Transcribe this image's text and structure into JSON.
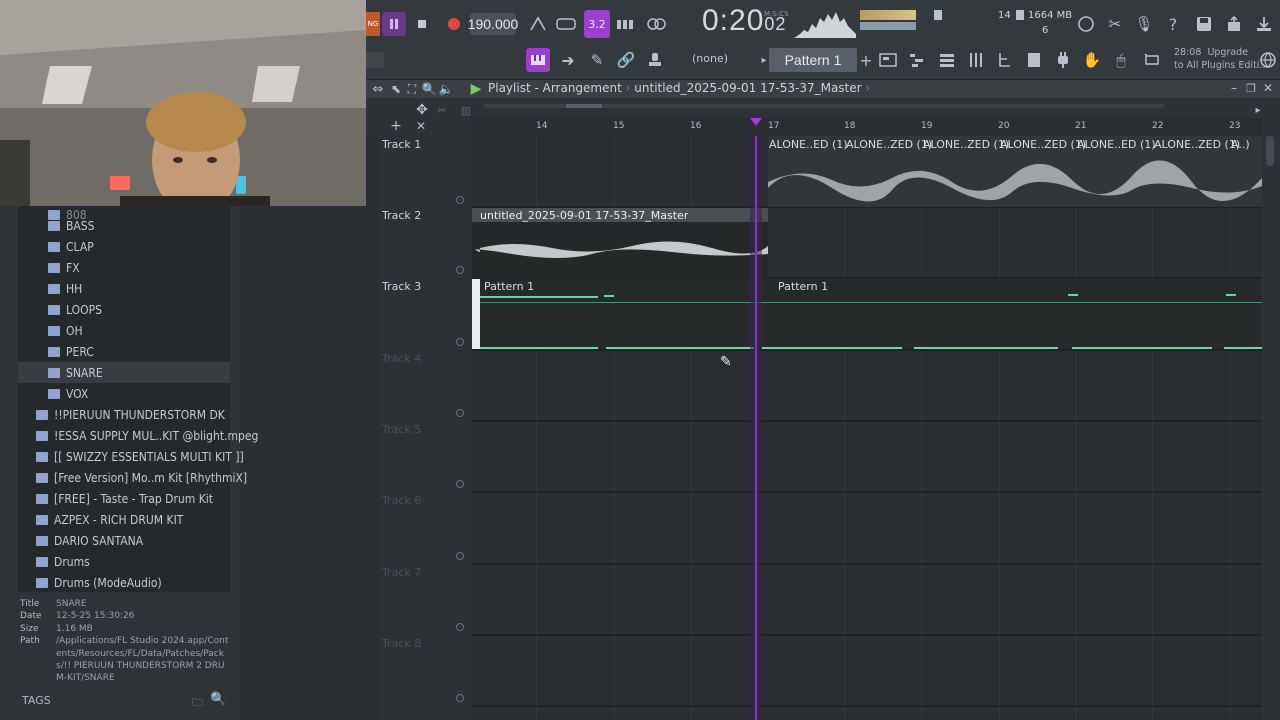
{
  "toolbar": {
    "tempo": "190.000",
    "time": "0:20",
    "time_fraction": "02",
    "time_label": "M:S:CS",
    "cpu": "14",
    "memory": "1664 MB",
    "voices": "6",
    "pattern": "Pattern 1",
    "none_label": "(none)",
    "upgrade_date": "28:08",
    "upgrade_line1": "Upgrade",
    "upgrade_line2": "to All Plugins Editi..",
    "mode_text": "3.2"
  },
  "playlist": {
    "title": "Playlist - Arrangement",
    "project": "untitled_2025-09-01 17-53-37_Master",
    "ruler": [
      "14",
      "15",
      "16",
      "17",
      "18",
      "19",
      "20",
      "21",
      "22",
      "23"
    ],
    "tracks": [
      "Track 1",
      "Track 2",
      "Track 3",
      "Track 4",
      "Track 5",
      "Track 6",
      "Track 7",
      "Track 8"
    ],
    "clips": {
      "alone": [
        "ALONE..ED (1)",
        "ALONE..ZED (1)",
        "ALONE..ZED (1)",
        "ALONE..ZED (1)",
        "ALONE..ED (1)",
        "ALONE..ZED (1)",
        "A..)"
      ],
      "master": "untitled_2025-09-01 17-53-37_Master",
      "pattern_a": "Pattern 1",
      "pattern_b": "Pattern 1"
    }
  },
  "browser": {
    "items": [
      "BASS",
      "CLAP",
      "FX",
      "HH",
      "LOOPS",
      "OH",
      "PERC",
      "SNARE",
      "VOX",
      "!!PIERUUN THUNDERSTORM DK",
      "!ESSA SUPPLY MUL..KIT @blight.mpeg",
      "[[ SWIZZY ESSENTIALS MULTI KIT ]]",
      "[Free Version] Mo..m Kit [RhythmiX]",
      "[FREE] - Taste - Trap Drum Kit",
      "AZPEX - RICH DRUM KIT",
      "DARIO SANTANA",
      "Drums",
      "Drums (ModeAudio)"
    ],
    "selected": "SNARE",
    "info": {
      "title_label": "Title",
      "title": "SNARE",
      "date_label": "Date",
      "date": "12-5-25 15:30:26",
      "size_label": "Size",
      "size": "1.16 MB",
      "path_label": "Path",
      "path": "/Applications/FL Studio 2024.app/Contents/Resources/FL/Data/Patches/Packs/!! PIERUUN THUNDERSTORM 2 DRUM-KIT/SNARE"
    },
    "tags_label": "TAGS"
  },
  "colors": {
    "accent": "#a23bd9",
    "pattern_green": "#4fd49a",
    "record_red": "#e0473f",
    "playhead": "#8a3fd1"
  }
}
